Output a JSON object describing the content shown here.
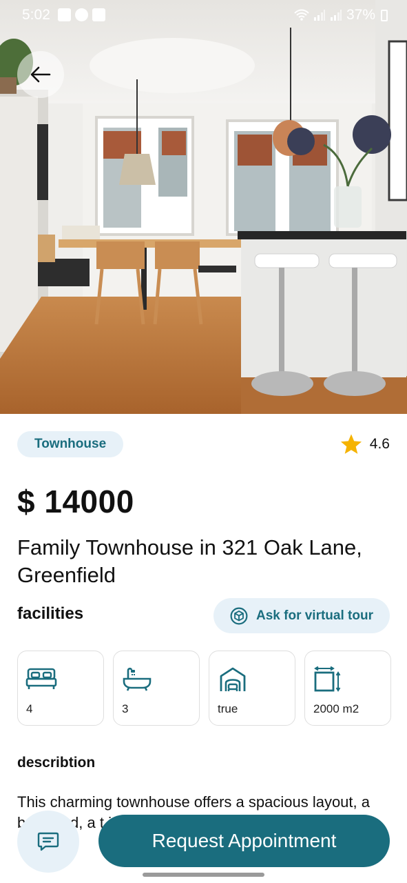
{
  "status_bar": {
    "time": "5:02",
    "battery": "37%",
    "left_icons": [
      "gallery-icon",
      "snapchat-icon",
      "youtube-icon"
    ],
    "right_icons": [
      "wifi-icon",
      "signal-icon",
      "signal-icon",
      "battery-icon"
    ]
  },
  "property": {
    "type": "Townhouse",
    "rating": "4.6",
    "price": "$ 14000",
    "title": "Family Townhouse in 321 Oak Lane, Greenfield"
  },
  "facilities": {
    "heading": "facilities",
    "virtual_tour_label": "Ask for virtual tour",
    "items": [
      {
        "icon": "bed-icon",
        "value": "4"
      },
      {
        "icon": "bathtub-icon",
        "value": "3"
      },
      {
        "icon": "garage-icon",
        "value": "true"
      },
      {
        "icon": "area-icon",
        "value": "2000 m2"
      }
    ]
  },
  "description": {
    "heading": "describtion",
    "text": "This charming townhouse offers a spacious layout, a backyard, a t id"
  },
  "actions": {
    "request_label": "Request Appointment",
    "chat_icon": "chat-icon"
  },
  "colors": {
    "accent": "#1a6d7e",
    "chip_bg": "#e7f1f8",
    "star": "#f5b301"
  }
}
